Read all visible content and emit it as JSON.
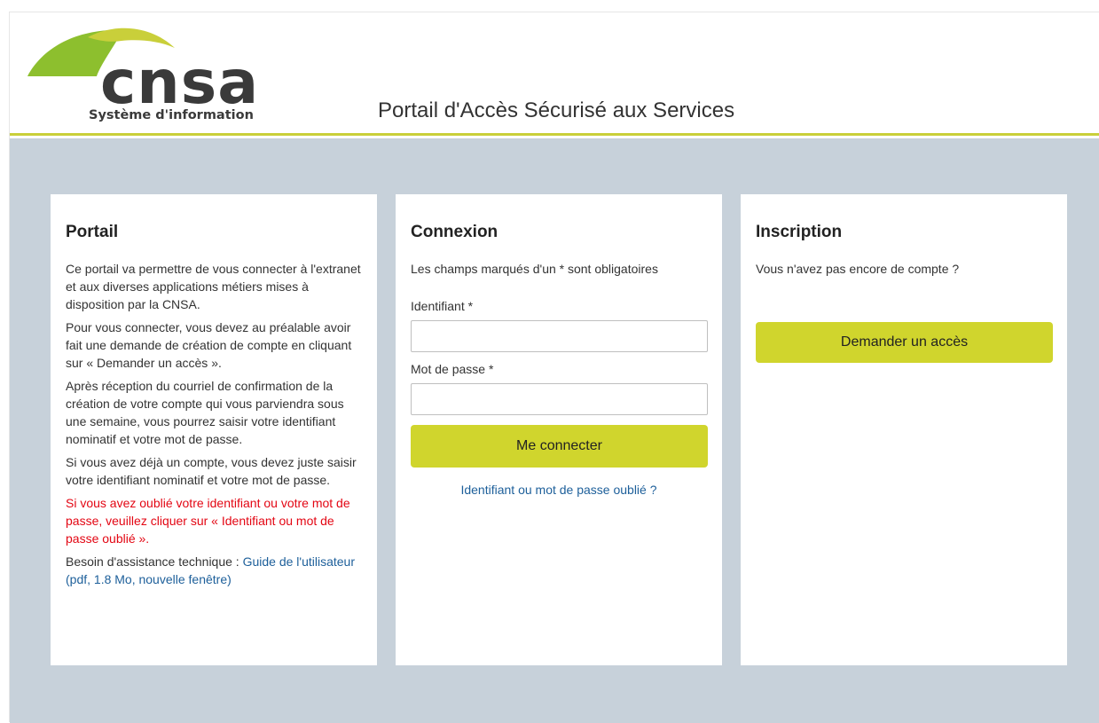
{
  "header": {
    "logo_text": "cnsa",
    "logo_subtitle": "Système d'information",
    "site_title": "Portail d'Accès Sécurisé aux Services"
  },
  "portail": {
    "title": "Portail",
    "paragraphs": [
      "Ce portail va permettre de vous connecter à l'extranet et aux diverses applications métiers mises à disposition par la CNSA.",
      "Pour vous connecter, vous devez au préalable avoir fait une demande de création de compte en cliquant sur « Demander un accès ».",
      "Après réception du courriel de confirmation de la création de votre compte qui vous parviendra sous une semaine, vous pourrez saisir votre identifiant nominatif et votre mot de passe.",
      "Si vous avez déjà un compte, vous devez juste saisir votre identifiant nominatif et votre mot de passe."
    ],
    "warning": "Si vous avez oublié votre identifiant ou votre mot de passe, veuillez cliquer sur « Identifiant ou mot de passe oublié ».",
    "assistance_prefix": "Besoin d'assistance technique : ",
    "guide_link": "Guide de l'utilisateur (pdf, 1.8 Mo, nouvelle fenêtre)"
  },
  "connexion": {
    "title": "Connexion",
    "required_note": "Les champs marqués d'un * sont obligatoires",
    "identifiant_label": "Identifiant *",
    "identifiant_value": "",
    "password_label": "Mot de passe *",
    "password_value": "",
    "submit_label": "Me connecter",
    "forgot_link": "Identifiant ou mot de passe oublié ?"
  },
  "inscription": {
    "title": "Inscription",
    "question": "Vous n'avez pas encore de compte ?",
    "request_label": "Demander un accès"
  },
  "colors": {
    "accent": "#d0d52d",
    "logo_green": "#8dbf2e",
    "logo_yellow": "#c9cf3a",
    "background": "#c7d1da",
    "link": "#1d5f9a",
    "warning": "#e30613"
  }
}
